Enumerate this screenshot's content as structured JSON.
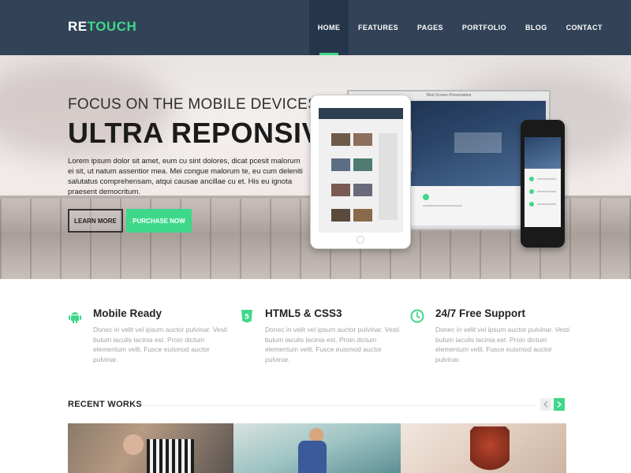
{
  "brand": {
    "part1": "RE",
    "part2": "TOUCH",
    "accent": "#3ed88a",
    "nav_bg": "#324357"
  },
  "nav": {
    "items": [
      {
        "label": "HOME",
        "active": true
      },
      {
        "label": "FEATURES",
        "active": false
      },
      {
        "label": "PAGES",
        "active": false
      },
      {
        "label": "PORTFOLIO",
        "active": false
      },
      {
        "label": "BLOG",
        "active": false
      },
      {
        "label": "CONTACT",
        "active": false
      }
    ]
  },
  "hero": {
    "subtitle": "FOCUS ON THE MOBILE DEVICES",
    "title": "ULTRA REPONSIVE",
    "text": "Lorem ipsum dolor sit amet, eum cu sint dolores, dicat pcesit malorum ei sit, ut natum assentior mea. Mei congue malorum te, eu cum deleniti salutatus comprehensam, atqui causae ancillae cu et. His eu ignota praesent democritum.",
    "learn_more": "LEARN MORE",
    "purchase": "PURCHASE NOW",
    "monitor_caption": "Web Screen Presentation"
  },
  "features": [
    {
      "icon": "android-icon",
      "title": "Mobile Ready",
      "text": "Donec in velit vel ipsum auctor pulvinar. Vesti bulum iaculis lacinia est. Proin dictum elementum velit. Fusce euismod auctor pulvinar."
    },
    {
      "icon": "html5-icon",
      "title": "HTML5 & CSS3",
      "text": "Donec in velit vel ipsum auctor pulvinar. Vesti bulum iaculis lacinia est. Proin dictum elementum velit. Fusce euismod auctor pulvinar."
    },
    {
      "icon": "clock-icon",
      "title": "24/7 Free Support",
      "text": "Donec in velit vel ipsum auctor pulvinar. Vesti bulum iaculis lacinia est. Proin dictum elementum velit. Fusce euismod auctor pulvinar."
    }
  ],
  "recent_works": {
    "title": "RECENT WORKS",
    "prev_icon": "chevron-left-icon",
    "next_icon": "chevron-right-icon"
  }
}
